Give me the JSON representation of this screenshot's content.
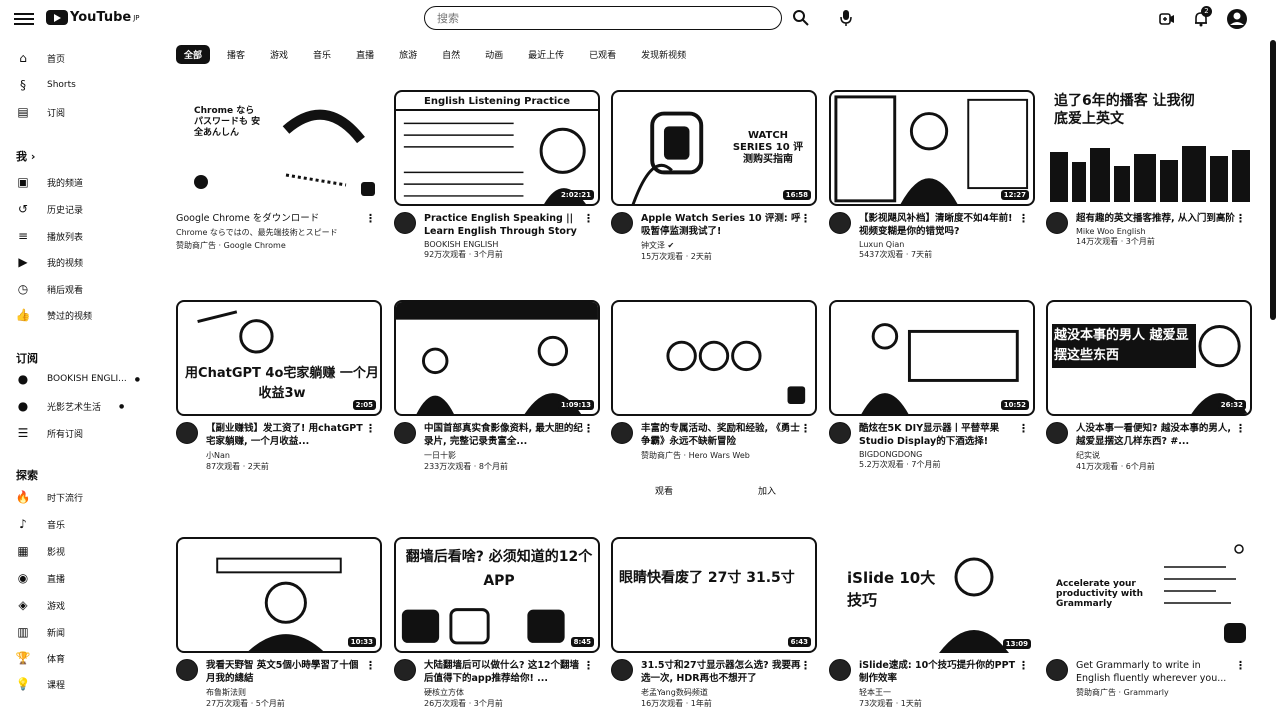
{
  "header": {
    "logo_text": "YouTube",
    "region": "JP",
    "search_placeholder": "搜索",
    "notifications_count": "2"
  },
  "sidebar": {
    "main": [
      {
        "label": "首页",
        "icon": "home-icon"
      },
      {
        "label": "Shorts",
        "icon": "shorts-icon"
      },
      {
        "label": "订阅",
        "icon": "subscriptions-icon"
      }
    ],
    "you_heading": "我 ›",
    "you": [
      {
        "label": "我的频道",
        "icon": "channel-icon"
      },
      {
        "label": "历史记录",
        "icon": "history-icon"
      },
      {
        "label": "播放列表",
        "icon": "playlist-icon"
      },
      {
        "label": "我的视频",
        "icon": "my-videos-icon"
      },
      {
        "label": "稍后观看",
        "icon": "watch-later-icon"
      },
      {
        "label": "赞过的视频",
        "icon": "like-icon"
      }
    ],
    "subs_heading": "订阅",
    "subs": [
      {
        "label": "BOOKISH ENGLI...",
        "icon": "channel-avatar-icon"
      },
      {
        "label": "光影艺术生活",
        "icon": "channel-avatar-icon"
      },
      {
        "label": "所有订阅",
        "icon": "list-icon"
      }
    ],
    "explore_heading": "探索",
    "explore": [
      {
        "label": "时下流行",
        "icon": "trending-icon"
      },
      {
        "label": "音乐",
        "icon": "music-icon"
      },
      {
        "label": "影视",
        "icon": "movies-icon"
      },
      {
        "label": "直播",
        "icon": "live-icon"
      },
      {
        "label": "游戏",
        "icon": "gaming-icon"
      },
      {
        "label": "新闻",
        "icon": "news-icon"
      },
      {
        "label": "体育",
        "icon": "sports-icon"
      },
      {
        "label": "课程",
        "icon": "courses-icon"
      }
    ]
  },
  "chips": [
    "全部",
    "播客",
    "游戏",
    "音乐",
    "直播",
    "旅游",
    "自然",
    "动画",
    "最近上传",
    "已观看",
    "发现新视频"
  ],
  "videos": [
    {
      "title": "Google Chrome をダウンロード",
      "line2": "Chrome ならではの、最先端技術とスピード",
      "channel": "赞助商广告 · Google Chrome",
      "stats": "",
      "duration": "",
      "thumb_text": "Chrome なら パスワードも 安全あんしん"
    },
    {
      "title": "Practice English Speaking || Learn English Through Story ||...",
      "line2": "",
      "channel": "BOOKISH ENGLISH",
      "stats": "92万次观看 · 3个月前",
      "duration": "2:02:21",
      "thumb_text": "English Listening Practice"
    },
    {
      "title": "Apple Watch Series 10 评测: 呼吸暂停监测我试了!",
      "line2": "",
      "channel": "钟文泽 ✔",
      "stats": "15万次观看 · 2天前",
      "duration": "16:58",
      "thumb_text": "WATCH SERIES 10 评测购买指南"
    },
    {
      "title": "【影视飓风补档】清晰度不如4年前! 视频变糊是你的错觉吗?",
      "line2": "",
      "channel": "Luxun Qian",
      "stats": "5437次观看 · 7天前",
      "duration": "12:27",
      "thumb_text": ""
    },
    {
      "title": "超有趣的英文播客推荐, 从入门到高阶",
      "line2": "",
      "channel": "Mike Woo English",
      "stats": "14万次观看 · 3个月前",
      "duration": "",
      "thumb_text": "追了6年的播客 让我彻底爱上英文"
    },
    {
      "title": "【副业赚钱】发工资了! 用chatGPT宅家躺赚, 一个月收益...",
      "line2": "",
      "channel": "小Nan",
      "stats": "87次观看 · 2天前",
      "duration": "2:05",
      "thumb_text": "用ChatGPT 4o宅家躺赚 一个月收益3w"
    },
    {
      "title": "中国首部真实食影像资料, 最大胆的纪录片, 完整记录贵富全...",
      "line2": "",
      "channel": "一日十影",
      "stats": "233万次观看 · 8个月前",
      "duration": "1:09:13",
      "thumb_text": ""
    },
    {
      "title": "丰富的专属活动、奖励和经验, 《勇士争霸》永远不缺新冒险",
      "line2": "",
      "channel": "赞助商广告 · Hero Wars Web",
      "stats": "",
      "duration": "",
      "thumb_text": ""
    },
    {
      "title": "酷炫在5K DIY显示器丨平替苹果 Studio Display的下酒选择!",
      "line2": "",
      "channel": "BIGDONGDONG",
      "stats": "5.2万次观看 · 7个月前",
      "duration": "10:52",
      "thumb_text": ""
    },
    {
      "title": "人没本事一看便知? 越没本事的男人, 越爱显摆这几样东西? #...",
      "line2": "",
      "channel": "纪实说",
      "stats": "41万次观看 · 6个月前",
      "duration": "26:32",
      "thumb_text": "越没本事的男人 越爱显摆这些东西"
    },
    {
      "title": "我看天野智 英文5個小時學習了十個月我的總結",
      "line2": "",
      "channel": "布鲁斯法则",
      "stats": "27万次观看 · 5个月前",
      "duration": "10:33",
      "thumb_text": ""
    },
    {
      "title": "大陆翻墙后可以做什么? 这12个翻墙后值得下的app推荐给你! ...",
      "line2": "",
      "channel": "硬核立方体",
      "stats": "26万次观看 · 3个月前",
      "duration": "8:45",
      "thumb_text": "翻墙后看啥? 必须知道的12个APP"
    },
    {
      "title": "31.5寸和27寸显示器怎么选? 我要再选一次, HDR再也不想开了",
      "line2": "",
      "channel": "老孟Yang数码频道",
      "stats": "16万次观看 · 1年前",
      "duration": "6:43",
      "thumb_text": "眼睛快看废了 27寸 31.5寸"
    },
    {
      "title": "iSlide速成: 10个技巧提升你的PPT制作效率",
      "line2": "",
      "channel": "轻本王一",
      "stats": "73次观看 · 1天前",
      "duration": "13:09",
      "thumb_text": "iSlide 10大技巧"
    },
    {
      "title": "Get Grammarly to write in English fluently wherever you...",
      "line2": "",
      "channel": "赞助商广告 · Grammarly",
      "stats": "",
      "duration": "",
      "thumb_text": "Accelerate your productivity with Grammarly"
    }
  ],
  "ad_actions": {
    "watch": "观看",
    "add": "加入"
  }
}
